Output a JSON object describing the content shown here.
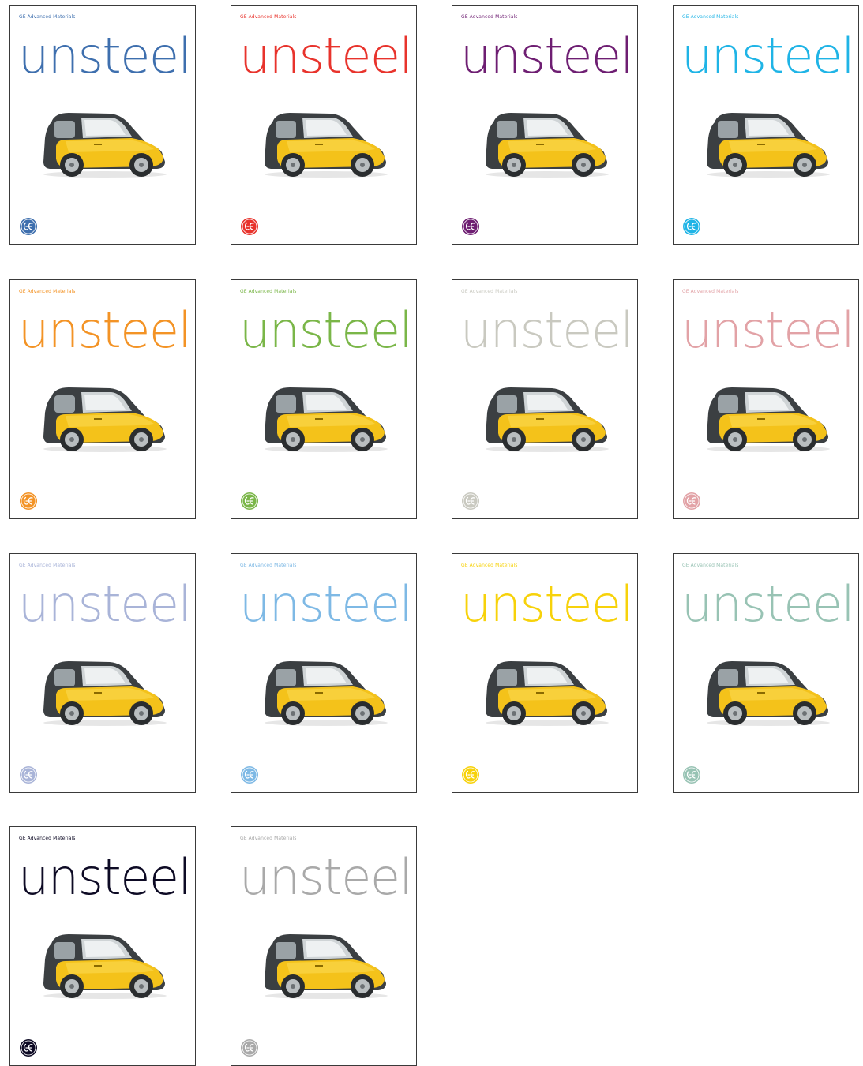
{
  "cards": [
    {
      "brand": "GE Advanced Materials",
      "word": "unsteel",
      "color": "#3e6fae",
      "logo_icon": "ge-monogram-icon",
      "image": "yellow-smart-car"
    },
    {
      "brand": "GE Advanced Materials",
      "word": "unsteel",
      "color": "#e8332c",
      "logo_icon": "ge-monogram-icon",
      "image": "yellow-smart-car"
    },
    {
      "brand": "GE Advanced Materials",
      "word": "unsteel",
      "color": "#6e1e72",
      "logo_icon": "ge-monogram-icon",
      "image": "yellow-smart-car"
    },
    {
      "brand": "GE Advanced Materials",
      "word": "unsteel",
      "color": "#1fb4e6",
      "logo_icon": "ge-monogram-icon",
      "image": "yellow-smart-car"
    },
    {
      "brand": "GE Advanced Materials",
      "word": "unsteel",
      "color": "#f39325",
      "logo_icon": "ge-monogram-icon",
      "image": "yellow-smart-car"
    },
    {
      "brand": "GE Advanced Materials",
      "word": "unsteel",
      "color": "#7ab648",
      "logo_icon": "ge-monogram-icon",
      "image": "yellow-smart-car"
    },
    {
      "brand": "GE Advanced Materials",
      "word": "unsteel",
      "color": "#c9c9c0",
      "logo_icon": "ge-monogram-icon",
      "image": "yellow-smart-car"
    },
    {
      "brand": "GE Advanced Materials",
      "word": "unsteel",
      "color": "#e2a2a6",
      "logo_icon": "ge-monogram-icon",
      "image": "yellow-smart-car"
    },
    {
      "brand": "GE Advanced Materials",
      "word": "unsteel",
      "color": "#a9b4d8",
      "logo_icon": "ge-monogram-icon",
      "image": "yellow-smart-car"
    },
    {
      "brand": "GE Advanced Materials",
      "word": "unsteel",
      "color": "#7eb9e5",
      "logo_icon": "ge-monogram-icon",
      "image": "yellow-smart-car"
    },
    {
      "brand": "GE Advanced Materials",
      "word": "unsteel",
      "color": "#f7d20a",
      "logo_icon": "ge-monogram-icon",
      "image": "yellow-smart-car"
    },
    {
      "brand": "GE Advanced Materials",
      "word": "unsteel",
      "color": "#98c3b4",
      "logo_icon": "ge-monogram-icon",
      "image": "yellow-smart-car"
    },
    {
      "brand": "GE Advanced Materials",
      "word": "unsteel",
      "color": "#0d0a24",
      "logo_icon": "ge-monogram-icon",
      "image": "yellow-smart-car"
    },
    {
      "brand": "GE Advanced Materials",
      "word": "unsteel",
      "color": "#a9a9a9",
      "logo_icon": "ge-monogram-icon",
      "image": "yellow-smart-car"
    }
  ]
}
